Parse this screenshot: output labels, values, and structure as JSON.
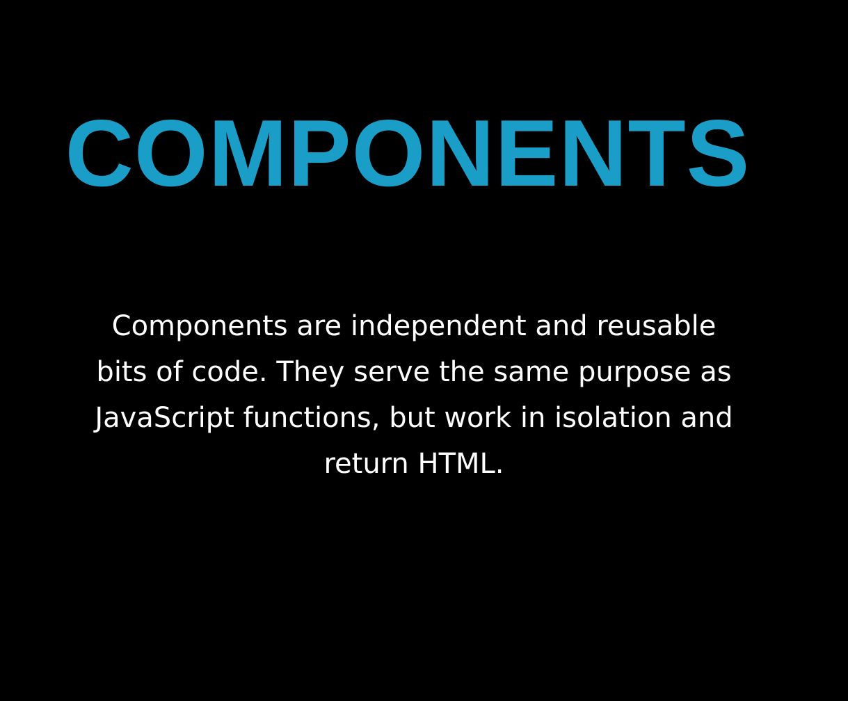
{
  "slide": {
    "title": "COMPONENTS",
    "body": "Components are independent and reusable bits of code. They serve the same purpose as JavaScript functions, but work in isolation and return HTML."
  },
  "colors": {
    "background": "#000000",
    "title": "#1a9ec7",
    "body": "#ffffff"
  }
}
